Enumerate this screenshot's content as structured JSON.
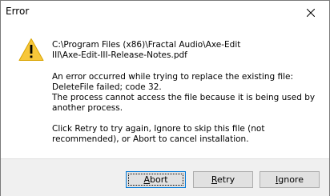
{
  "window": {
    "title": "Error",
    "close_icon": "close-icon"
  },
  "message": {
    "icon": "warning-icon",
    "icon_color": "#f7c73a",
    "path_lines": "C:\\Program Files (x86)\\Fractal Audio\\Axe-Edit\nIII\\Axe-Edit-III-Release-Notes.pdf",
    "error_lines": "An error occurred while trying to replace the existing file:\nDeleteFile failed; code 32.\nThe process cannot access the file because it is being used by\nanother process.",
    "instruction_lines": "Click Retry to try again, Ignore to skip this file (not\nrecommended), or Abort to cancel installation."
  },
  "buttons": {
    "abort": {
      "accel": "A",
      "rest": "bort"
    },
    "retry": {
      "accel": "R",
      "rest": "etry"
    },
    "ignore": {
      "accel": "I",
      "rest": "gnore"
    }
  }
}
